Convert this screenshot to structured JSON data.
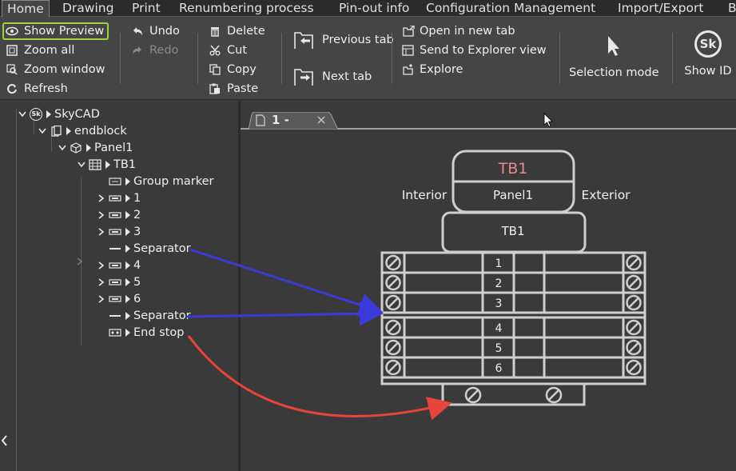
{
  "menu": {
    "tabs": [
      "Home",
      "Drawing",
      "Print",
      "Renumbering process",
      "Pin-out info",
      "Configuration Management",
      "Import/Export",
      "B"
    ]
  },
  "ribbon": {
    "view_group": {
      "show_preview": "Show Preview",
      "zoom_all": "Zoom all",
      "zoom_window": "Zoom window",
      "refresh": "Refresh"
    },
    "history_group": {
      "undo": "Undo",
      "redo": "Redo"
    },
    "edit_group": {
      "delete": "Delete",
      "cut": "Cut",
      "copy": "Copy",
      "paste": "Paste"
    },
    "tab_group": {
      "previous_tab": "Previous tab",
      "next_tab": "Next tab"
    },
    "explorer_group": {
      "open_new_tab": "Open in new tab",
      "send_explorer": "Send to Explorer view",
      "explore": "Explore"
    },
    "selection_mode": "Selection mode",
    "show_id": "Show ID",
    "show_id_badge": "Sk"
  },
  "tree": {
    "root": "SkyCAD",
    "root_badge": "Sk",
    "endblock": "endblock",
    "panel": "Panel1",
    "tb": "TB1",
    "children": [
      {
        "label": "Group marker",
        "icon": "group-marker-icon",
        "expandable": false
      },
      {
        "label": "1",
        "icon": "terminal-icon",
        "expandable": true
      },
      {
        "label": "2",
        "icon": "terminal-icon",
        "expandable": true
      },
      {
        "label": "3",
        "icon": "terminal-icon",
        "expandable": true
      },
      {
        "label": "Separator",
        "icon": "separator-icon",
        "expandable": false
      },
      {
        "label": "4",
        "icon": "terminal-icon",
        "expandable": true
      },
      {
        "label": "5",
        "icon": "terminal-icon",
        "expandable": true
      },
      {
        "label": "6",
        "icon": "terminal-icon",
        "expandable": true
      },
      {
        "label": "Separator",
        "icon": "separator-icon",
        "expandable": false
      },
      {
        "label": "End stop",
        "icon": "end-stop-icon",
        "expandable": false
      }
    ]
  },
  "document": {
    "tab_label": "1 -",
    "diagram": {
      "header_title": "TB1",
      "header_panel": "Panel1",
      "label_interior": "Interior",
      "label_exterior": "Exterior",
      "block_label": "TB1",
      "terminals": [
        "1",
        "2",
        "3",
        "4",
        "5",
        "6"
      ]
    }
  },
  "colors": {
    "accent_green": "#9bd53b",
    "title_red": "#e88a8a",
    "arrow_blue": "#3b3bd9",
    "arrow_red": "#e8453a",
    "diagram_line": "#cfcfcf"
  }
}
